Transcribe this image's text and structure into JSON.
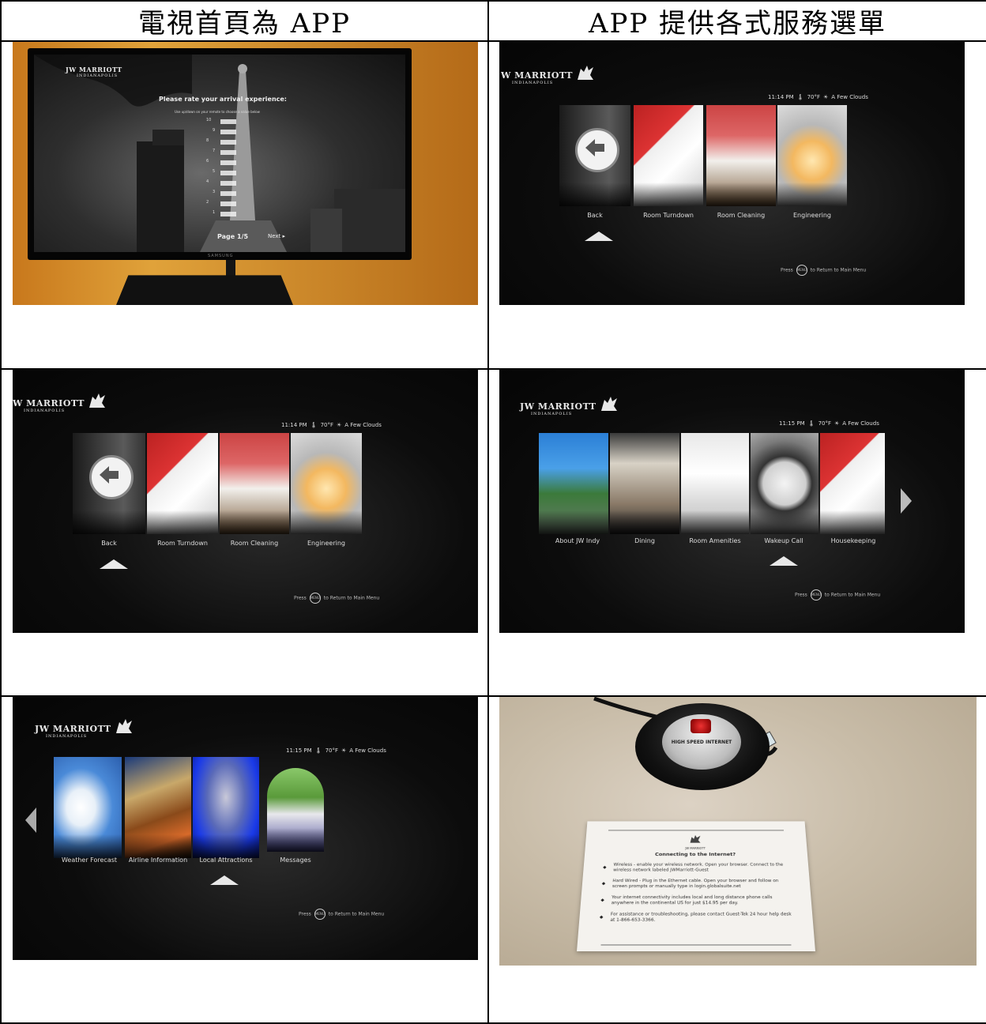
{
  "headers": {
    "left": "電視首頁為 APP",
    "right": "APP 提供各式服務選單"
  },
  "brand": {
    "name": "JW MARRIOTT",
    "name_cropped": "W MARRIOTT",
    "location": "INDIANAPOLIS"
  },
  "tv_survey": {
    "title": "Please rate your arrival experience:",
    "subtitle": "Use up/down on your remote to choose a value below",
    "scale": [
      "10",
      "9",
      "8",
      "7",
      "6",
      "5",
      "4",
      "3",
      "2",
      "1"
    ],
    "page": "Page 1/5",
    "next": "Next",
    "tv_brand": "SAMSUNG"
  },
  "status": {
    "time_1114": "11:14 PM",
    "time_1115": "11:15 PM",
    "temp": "70°F",
    "weather": "A Few Clouds"
  },
  "menu_a": [
    "Back",
    "Room Turndown",
    "Room Cleaning",
    "Engineering"
  ],
  "menu_b": [
    "About JW Indy",
    "Dining",
    "Room Amenities",
    "Wakeup Call",
    "Housekeeping"
  ],
  "menu_c": [
    "Weather Forecast",
    "Airline Information",
    "Local Attractions",
    "Messages"
  ],
  "press_hint": {
    "press": "Press",
    "button": "MENU",
    "action": "to Return to Main Menu"
  },
  "internet_card": {
    "puck_label": "HIGH SPEED INTERNET",
    "logo": "JW MARRIOTT",
    "heading": "Connecting to the Internet?",
    "bullets": [
      "Wireless - enable your wireless network. Open your browser. Connect to the wireless network labeled JWMarriott-Guest",
      "Hard Wired - Plug in the Ethernet cable. Open your browser and follow on screen prompts or manually type in login.globalsuite.net",
      "Your internet connectivity includes local and long distance phone calls anywhere in the continental US for just $14.95 per day.",
      "For assistance or troubleshooting, please contact Guest-Tek 24 hour help desk at 1-866-653-3366."
    ]
  },
  "colors": {
    "screen_bg": "#0c0c0c",
    "wall": "#d8902c",
    "counter": "#cfc3b0"
  }
}
